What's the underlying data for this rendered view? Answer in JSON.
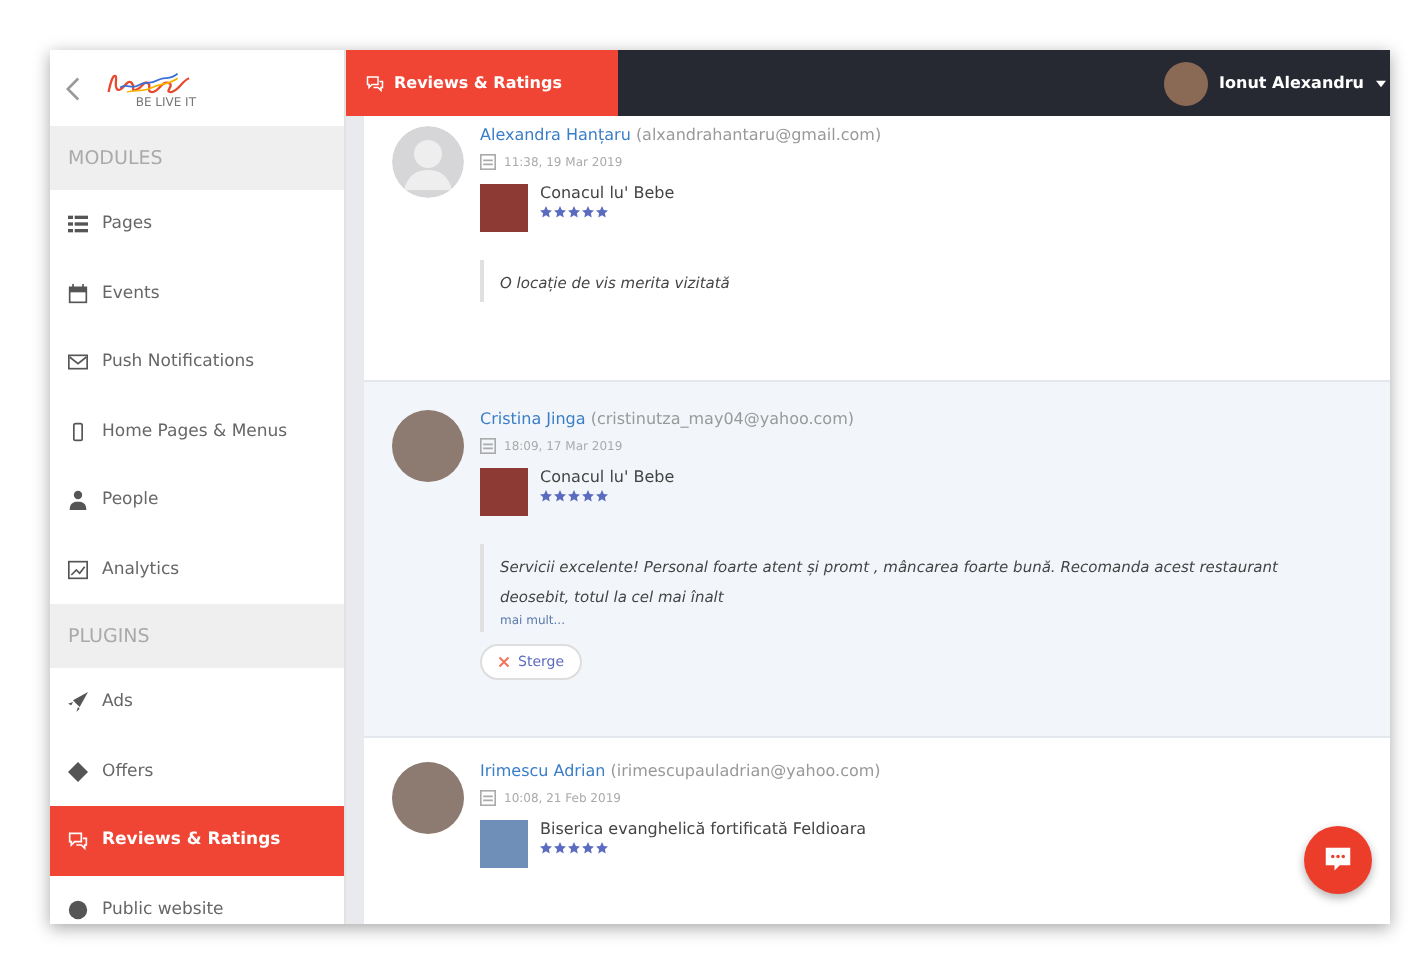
{
  "logo": {
    "tagline": "BE LIVE IT"
  },
  "sidebar": {
    "sections": [
      {
        "title": "MODULES",
        "items": [
          {
            "label": "Pages",
            "selected": false
          },
          {
            "label": "Events",
            "selected": false
          },
          {
            "label": "Push Notifications",
            "selected": false
          },
          {
            "label": "Home Pages & Menus",
            "selected": false
          },
          {
            "label": "People",
            "selected": false
          },
          {
            "label": "Analytics",
            "selected": false
          }
        ]
      },
      {
        "title": "PLUGINS",
        "items": [
          {
            "label": "Ads",
            "selected": false
          },
          {
            "label": "Offers",
            "selected": false
          },
          {
            "label": "Reviews & Ratings",
            "selected": true
          },
          {
            "label": "Public website",
            "selected": false
          }
        ]
      }
    ]
  },
  "topbar": {
    "title": "Reviews & Ratings",
    "user": "Ionut Alexandru"
  },
  "reviews": [
    {
      "name": "Alexandra Hanțaru",
      "email": "(alxandrahantaru@gmail.com)",
      "date": "11:38, 19 Mar 2019",
      "place": "Conacul lu' Bebe",
      "stars": 5,
      "text": "O locație de vis merita vizitată",
      "photo": false,
      "selected": false
    },
    {
      "name": "Cristina Jinga",
      "email": "(cristinutza_may04@yahoo.com)",
      "date": "18:09, 17 Mar 2019",
      "place": "Conacul lu' Bebe",
      "stars": 5,
      "text": "Servicii excelente! Personal foarte atent și promt , mâncarea foarte bună. Recomanda acest restaurant deosebit, totul la cel mai înalt",
      "more": "mai mult...",
      "delete": "Sterge",
      "photo": true,
      "selected": true
    },
    {
      "name": "Irimescu Adrian",
      "email": "(irimescupauladrian@yahoo.com)",
      "date": "10:08, 21 Feb 2019",
      "place": "Biserica evanghelică fortificată Feldioara",
      "stars": 5,
      "photo": true,
      "selected": false
    }
  ]
}
